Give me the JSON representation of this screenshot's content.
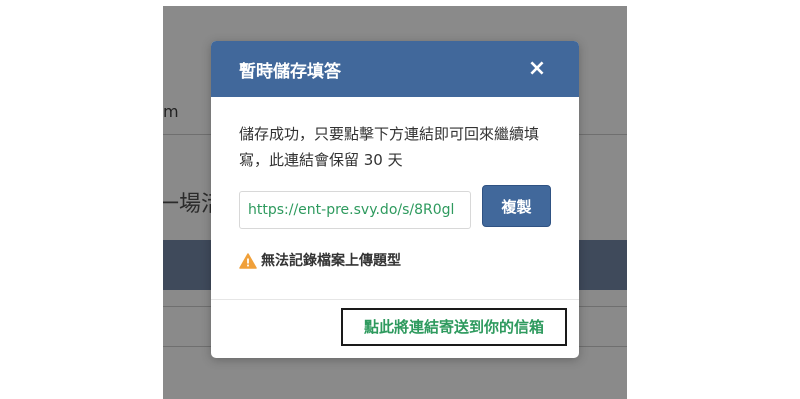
{
  "background": {
    "partial_text_m": "m",
    "partial_title": "一場活"
  },
  "modal": {
    "title": "暫時儲存填答",
    "close_symbol": "×",
    "message": "儲存成功，只要點擊下方連結即可回來繼續填寫，此連結會保留 30 天",
    "url_value": "https://ent-pre.svy.do/s/8R0gl",
    "copy_label": "複製",
    "warning_text": "無法記錄檔案上傳題型",
    "email_link_label": "點此將連結寄送到你的信箱"
  },
  "colors": {
    "header": "#41689b",
    "link_green": "#2e9a5e",
    "warning": "#f0a03a",
    "backdrop": "#8a8a8a"
  },
  "icons": {
    "close": "close-icon",
    "warning": "warning-triangle-icon"
  }
}
